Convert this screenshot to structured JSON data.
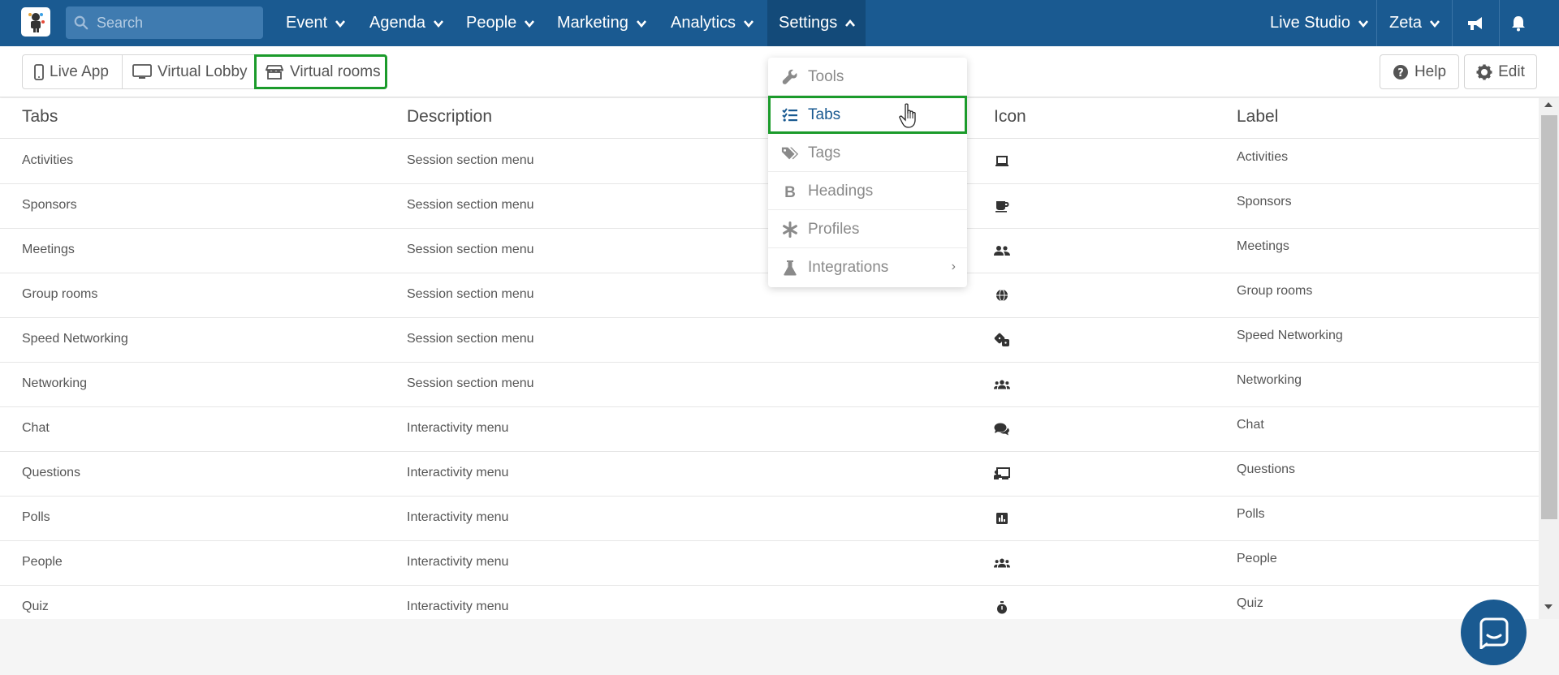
{
  "topnav": {
    "search_placeholder": "Search",
    "items": [
      {
        "label": "Event"
      },
      {
        "label": "Agenda"
      },
      {
        "label": "People"
      },
      {
        "label": "Marketing"
      },
      {
        "label": "Analytics"
      },
      {
        "label": "Settings"
      }
    ],
    "right_items": [
      {
        "label": "Live Studio"
      },
      {
        "label": "Zeta"
      }
    ]
  },
  "subbar": {
    "tabs": [
      {
        "label": "Live App"
      },
      {
        "label": "Virtual Lobby"
      },
      {
        "label": "Virtual rooms"
      }
    ],
    "help_label": "Help",
    "edit_label": "Edit"
  },
  "table": {
    "headers": [
      "Tabs",
      "Description",
      "Icon",
      "Label"
    ],
    "rows": [
      {
        "tab": "Activities",
        "description": "Session section menu",
        "icon": "laptop-icon",
        "label": "Activities"
      },
      {
        "tab": "Sponsors",
        "description": "Session section menu",
        "icon": "coffee-icon",
        "label": "Sponsors"
      },
      {
        "tab": "Meetings",
        "description": "Session section menu",
        "icon": "user-friends-icon",
        "label": "Meetings"
      },
      {
        "tab": "Group rooms",
        "description": "Session section menu",
        "icon": "globe-icon",
        "label": "Group rooms"
      },
      {
        "tab": "Speed Networking",
        "description": "Session section menu",
        "icon": "dice-icon",
        "label": "Speed Networking"
      },
      {
        "tab": "Networking",
        "description": "Session section menu",
        "icon": "users-icon",
        "label": "Networking"
      },
      {
        "tab": "Chat",
        "description": "Interactivity menu",
        "icon": "comments-icon",
        "label": "Chat"
      },
      {
        "tab": "Questions",
        "description": "Interactivity menu",
        "icon": "chalkboard-icon",
        "label": "Questions"
      },
      {
        "tab": "Polls",
        "description": "Interactivity menu",
        "icon": "poll-icon",
        "label": "Polls"
      },
      {
        "tab": "People",
        "description": "Interactivity menu",
        "icon": "users-icon",
        "label": "People"
      },
      {
        "tab": "Quiz",
        "description": "Interactivity menu",
        "icon": "stopwatch-icon",
        "label": "Quiz"
      }
    ]
  },
  "settings_menu": {
    "items": [
      {
        "label": "Tools",
        "icon": "wrench-icon"
      },
      {
        "label": "Tabs",
        "icon": "tasks-icon"
      },
      {
        "label": "Tags",
        "icon": "tags-icon"
      },
      {
        "label": "Headings",
        "icon": "bold-icon"
      },
      {
        "label": "Profiles",
        "icon": "asterisk-icon"
      },
      {
        "label": "Integrations",
        "icon": "flask-icon"
      }
    ]
  },
  "colors": {
    "nav_bg": "#1a5a91",
    "highlight": "#1b9b2b",
    "active_link": "#1a5a91"
  }
}
